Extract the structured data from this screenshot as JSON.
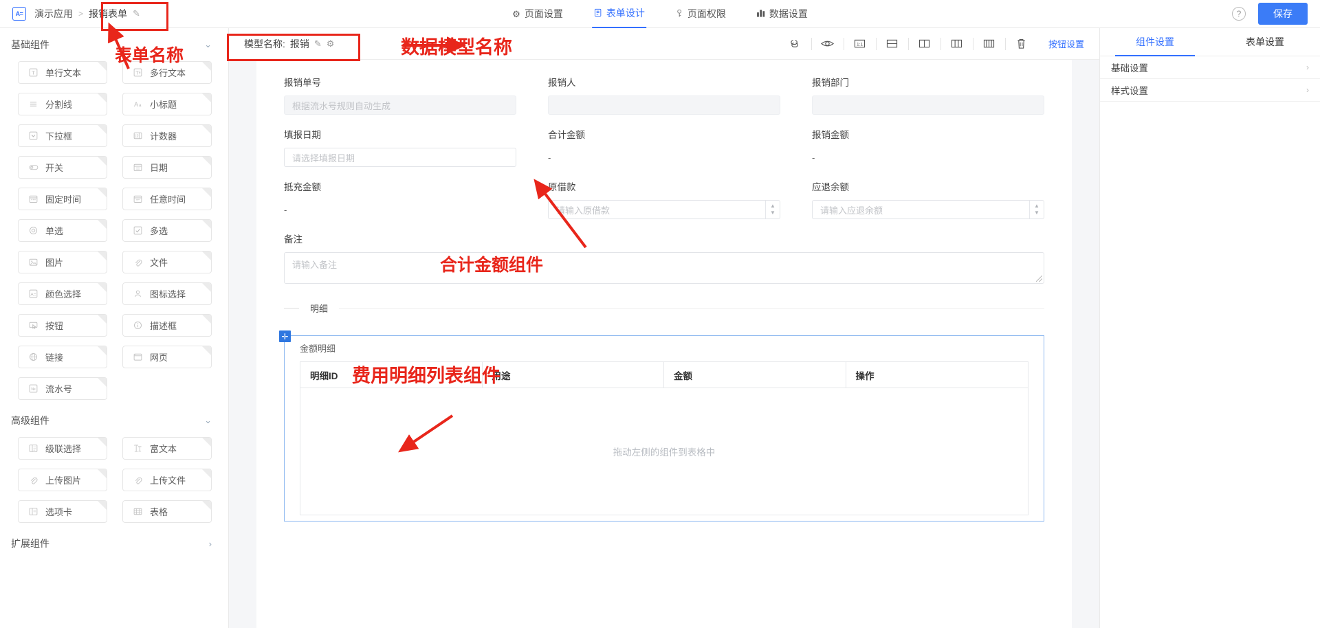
{
  "topbar": {
    "logo_text": "A=",
    "breadcrumb": {
      "app": "演示应用",
      "separator": ">",
      "current": "报销表单",
      "edit_icon": "✎"
    },
    "nav": [
      {
        "label": "页面设置",
        "icon": "gear-icon",
        "glyph": "⚙",
        "active": false
      },
      {
        "label": "表单设计",
        "icon": "document-icon",
        "glyph": "▤",
        "active": true
      },
      {
        "label": "页面权限",
        "icon": "key-icon",
        "glyph": "ᛞ",
        "active": false
      },
      {
        "label": "数据设置",
        "icon": "chart-icon",
        "glyph": "▥",
        "active": false
      }
    ],
    "help_label": "?",
    "save_label": "保存"
  },
  "sidebar": {
    "groups": [
      {
        "title": "基础组件",
        "collapsible": true,
        "chevron": "⌄",
        "items": [
          {
            "label": "单行文本",
            "icon": "single-line-text-icon"
          },
          {
            "label": "多行文本",
            "icon": "multi-line-text-icon"
          },
          {
            "label": "分割线",
            "icon": "divider-icon"
          },
          {
            "label": "小标题",
            "icon": "subtitle-icon"
          },
          {
            "label": "下拉框",
            "icon": "dropdown-icon"
          },
          {
            "label": "计数器",
            "icon": "counter-icon"
          },
          {
            "label": "开关",
            "icon": "switch-icon"
          },
          {
            "label": "日期",
            "icon": "date-icon"
          },
          {
            "label": "固定时间",
            "icon": "fixed-time-icon"
          },
          {
            "label": "任意时间",
            "icon": "any-time-icon"
          },
          {
            "label": "单选",
            "icon": "radio-icon"
          },
          {
            "label": "多选",
            "icon": "checkbox-icon"
          },
          {
            "label": "图片",
            "icon": "image-icon"
          },
          {
            "label": "文件",
            "icon": "file-icon"
          },
          {
            "label": "颜色选择",
            "icon": "color-picker-icon"
          },
          {
            "label": "图标选择",
            "icon": "icon-picker-icon"
          },
          {
            "label": "按钮",
            "icon": "button-icon"
          },
          {
            "label": "描述框",
            "icon": "description-icon"
          },
          {
            "label": "链接",
            "icon": "link-icon"
          },
          {
            "label": "网页",
            "icon": "webpage-icon"
          },
          {
            "label": "流水号",
            "icon": "serial-number-icon"
          }
        ]
      },
      {
        "title": "高级组件",
        "collapsible": true,
        "chevron": "⌄",
        "items": [
          {
            "label": "级联选择",
            "icon": "cascader-icon"
          },
          {
            "label": "富文本",
            "icon": "rich-text-icon"
          },
          {
            "label": "上传图片",
            "icon": "upload-image-icon"
          },
          {
            "label": "上传文件",
            "icon": "upload-file-icon"
          },
          {
            "label": "选项卡",
            "icon": "tabs-icon"
          },
          {
            "label": "表格",
            "icon": "table-icon"
          }
        ]
      },
      {
        "title": "扩展组件",
        "collapsible": true,
        "chevron": "›",
        "items": []
      }
    ]
  },
  "canvas_toolbar": {
    "model_label": "模型名称:",
    "model_value": "报销",
    "edit_icon": "✎",
    "settings_icon": "⚙",
    "tools": [
      {
        "name": "link-component-icon"
      },
      {
        "name": "preview-eye-icon"
      },
      {
        "name": "one-column-icon"
      },
      {
        "name": "two-row-icon"
      },
      {
        "name": "two-column-icon"
      },
      {
        "name": "three-column-icon"
      },
      {
        "name": "four-column-icon"
      },
      {
        "name": "delete-trash-icon"
      }
    ],
    "button_settings_label": "按钮设置"
  },
  "form": {
    "rows": [
      [
        {
          "label": "报销单号",
          "type": "input",
          "placeholder": "根据流水号规则自动生成",
          "state": "disabled"
        },
        {
          "label": "报销人",
          "type": "input",
          "placeholder": "",
          "state": "disabled"
        },
        {
          "label": "报销部门",
          "type": "input",
          "placeholder": "",
          "state": "disabled"
        }
      ],
      [
        {
          "label": "填报日期",
          "type": "input",
          "placeholder": "请选择填报日期",
          "state": "normal"
        },
        {
          "label": "合计金额",
          "type": "value",
          "value": "-"
        },
        {
          "label": "报销金额",
          "type": "value",
          "value": "-"
        }
      ],
      [
        {
          "label": "抵充金额",
          "type": "value",
          "value": "-"
        },
        {
          "label": "原借款",
          "type": "stepper",
          "placeholder": "请输入原借款",
          "state": "normal"
        },
        {
          "label": "应退余额",
          "type": "stepper",
          "placeholder": "请输入应退余额",
          "state": "normal"
        }
      ]
    ],
    "remark": {
      "label": "备注",
      "placeholder": "请输入备注"
    },
    "divider": {
      "text": "明细"
    },
    "detail_table": {
      "title": "金额明细",
      "columns": [
        "明细ID",
        "用途",
        "金额",
        "操作"
      ],
      "empty_text": "拖动左侧的组件到表格中"
    }
  },
  "right_panel": {
    "tabs": [
      {
        "label": "组件设置",
        "active": true
      },
      {
        "label": "表单设置",
        "active": false
      }
    ],
    "rows": [
      {
        "label": "基础设置",
        "chevron": "›"
      },
      {
        "label": "样式设置",
        "chevron": "›"
      }
    ]
  },
  "annotations": [
    {
      "id": "form-name",
      "text": "表单名称"
    },
    {
      "id": "model-name",
      "text": "数据模型名称"
    },
    {
      "id": "total-amount",
      "text": "合计金额组件"
    },
    {
      "id": "detail-list",
      "text": "费用明细列表组件"
    }
  ],
  "colors": {
    "accent": "#3370ff",
    "save_button": "#3b7cf7",
    "annotation_red": "#e8261b",
    "canvas_bg": "#f5f6f8",
    "table_border": "#8bb7f0"
  }
}
